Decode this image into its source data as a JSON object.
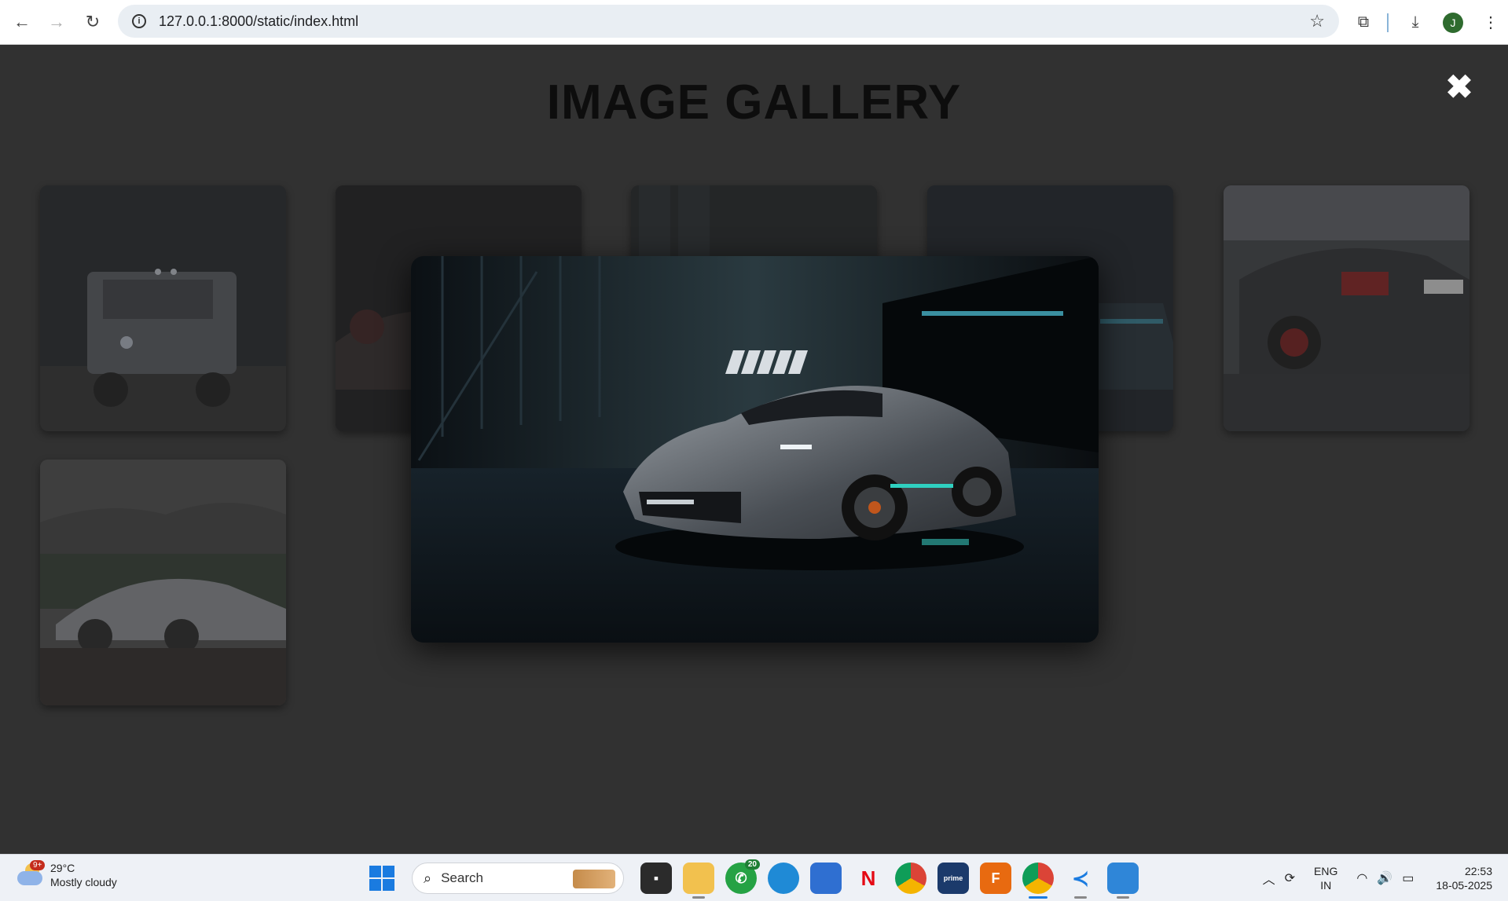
{
  "browser": {
    "url": "127.0.0.1:8000/static/index.html",
    "profile_initial": "J"
  },
  "page": {
    "title": "IMAGE GALLERY",
    "close_label": "✖"
  },
  "gallery": {
    "thumbnails": [
      {
        "name": "white-suv-night"
      },
      {
        "name": "red-car-dark"
      },
      {
        "name": "garage-car"
      },
      {
        "name": "car-neon"
      },
      {
        "name": "black-sedan-rear"
      },
      {
        "name": "silver-hypercar-desert"
      }
    ],
    "lightbox_image": "silver-hypercar-garage"
  },
  "taskbar": {
    "weather_temp": "29°C",
    "weather_desc": "Mostly cloudy",
    "weather_badge": "9+",
    "search_label": "Search",
    "whatsapp_badge": "20",
    "lang_line1": "ENG",
    "lang_line2": "IN",
    "time": "22:53",
    "date": "18-05-2025"
  },
  "colors": {
    "overlay_bg": "#313131",
    "title_color": "#0d0d0d",
    "accent": "#1a7be0"
  }
}
